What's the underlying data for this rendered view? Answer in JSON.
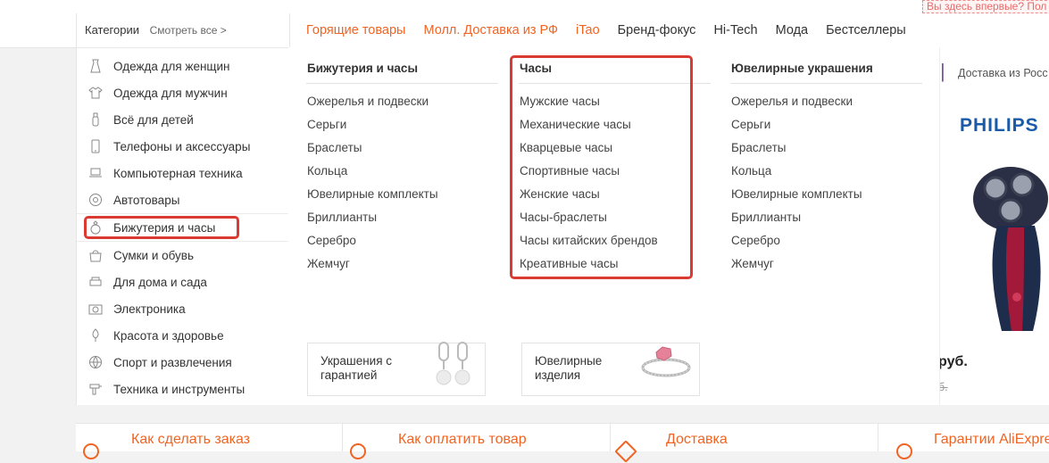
{
  "top": {
    "first_time": "Вы здесь впервые? Пол"
  },
  "categories": {
    "title": "Категории",
    "see_all": "Смотреть все >",
    "items": [
      {
        "label": "Одежда для женщин",
        "icon": "dress-icon"
      },
      {
        "label": "Одежда для мужчин",
        "icon": "shirt-icon"
      },
      {
        "label": "Всё для детей",
        "icon": "bottle-icon"
      },
      {
        "label": "Телефоны и аксессуары",
        "icon": "phone-icon"
      },
      {
        "label": "Компьютерная техника",
        "icon": "laptop-icon"
      },
      {
        "label": "Автотовары",
        "icon": "wheel-icon"
      },
      {
        "label": "Бижутерия и часы",
        "icon": "ring-icon"
      },
      {
        "label": "Сумки и обувь",
        "icon": "bag-icon"
      },
      {
        "label": "Для дома и сада",
        "icon": "sofa-icon"
      },
      {
        "label": "Электроника",
        "icon": "camera-icon"
      },
      {
        "label": "Красота и здоровье",
        "icon": "lipstick-icon"
      },
      {
        "label": "Спорт и развлечения",
        "icon": "ball-icon"
      },
      {
        "label": "Техника и инструменты",
        "icon": "drill-icon"
      }
    ]
  },
  "topnav": [
    {
      "label": "Горящие товары",
      "style": "hot"
    },
    {
      "label": "Молл. Доставка из РФ",
      "style": "hot"
    },
    {
      "label": "iTao",
      "style": "hot"
    },
    {
      "label": "Бренд-фокус",
      "style": "dark"
    },
    {
      "label": "Hi-Tech",
      "style": "dark"
    },
    {
      "label": "Мода",
      "style": "dark"
    },
    {
      "label": "Бестселлеры",
      "style": "dark"
    }
  ],
  "dropdown": {
    "columns": [
      {
        "title": "Бижутерия и часы",
        "items": [
          "Ожерелья и подвески",
          "Серьги",
          "Браслеты",
          "Кольца",
          "Ювелирные комплекты",
          "Бриллианты",
          "Серебро",
          "Жемчуг"
        ]
      },
      {
        "title": "Часы",
        "items": [
          "Мужские часы",
          "Механические часы",
          "Кварцевые часы",
          "Спортивные часы",
          "Женские часы",
          "Часы-браслеты",
          "Часы китайских брендов",
          "Креативные часы"
        ]
      },
      {
        "title": "Ювелирные украшения",
        "items": [
          "Ожерелья и подвески",
          "Серьги",
          "Браслеты",
          "Кольца",
          "Ювелирные комплекты",
          "Бриллианты",
          "Серебро",
          "Жемчуг"
        ]
      }
    ],
    "promos": [
      {
        "label": "Украшения с гарантией",
        "image": "pearl-earrings-image"
      },
      {
        "label": "Ювелирные изделия",
        "image": "diamond-ring-image"
      }
    ]
  },
  "banner": {
    "delivery": "Доставка из Росс",
    "brand": "PHILIPS",
    "price": "руб.",
    "old_price": "б."
  },
  "bottom": [
    {
      "label": "Как сделать заказ"
    },
    {
      "label": "Как оплатить товар"
    },
    {
      "label": "Доставка"
    },
    {
      "label": "Гарантии AliExpre"
    }
  ],
  "colors": {
    "accent": "#f06423",
    "highlight": "#d93a32",
    "brand": "#1a5aa6"
  }
}
